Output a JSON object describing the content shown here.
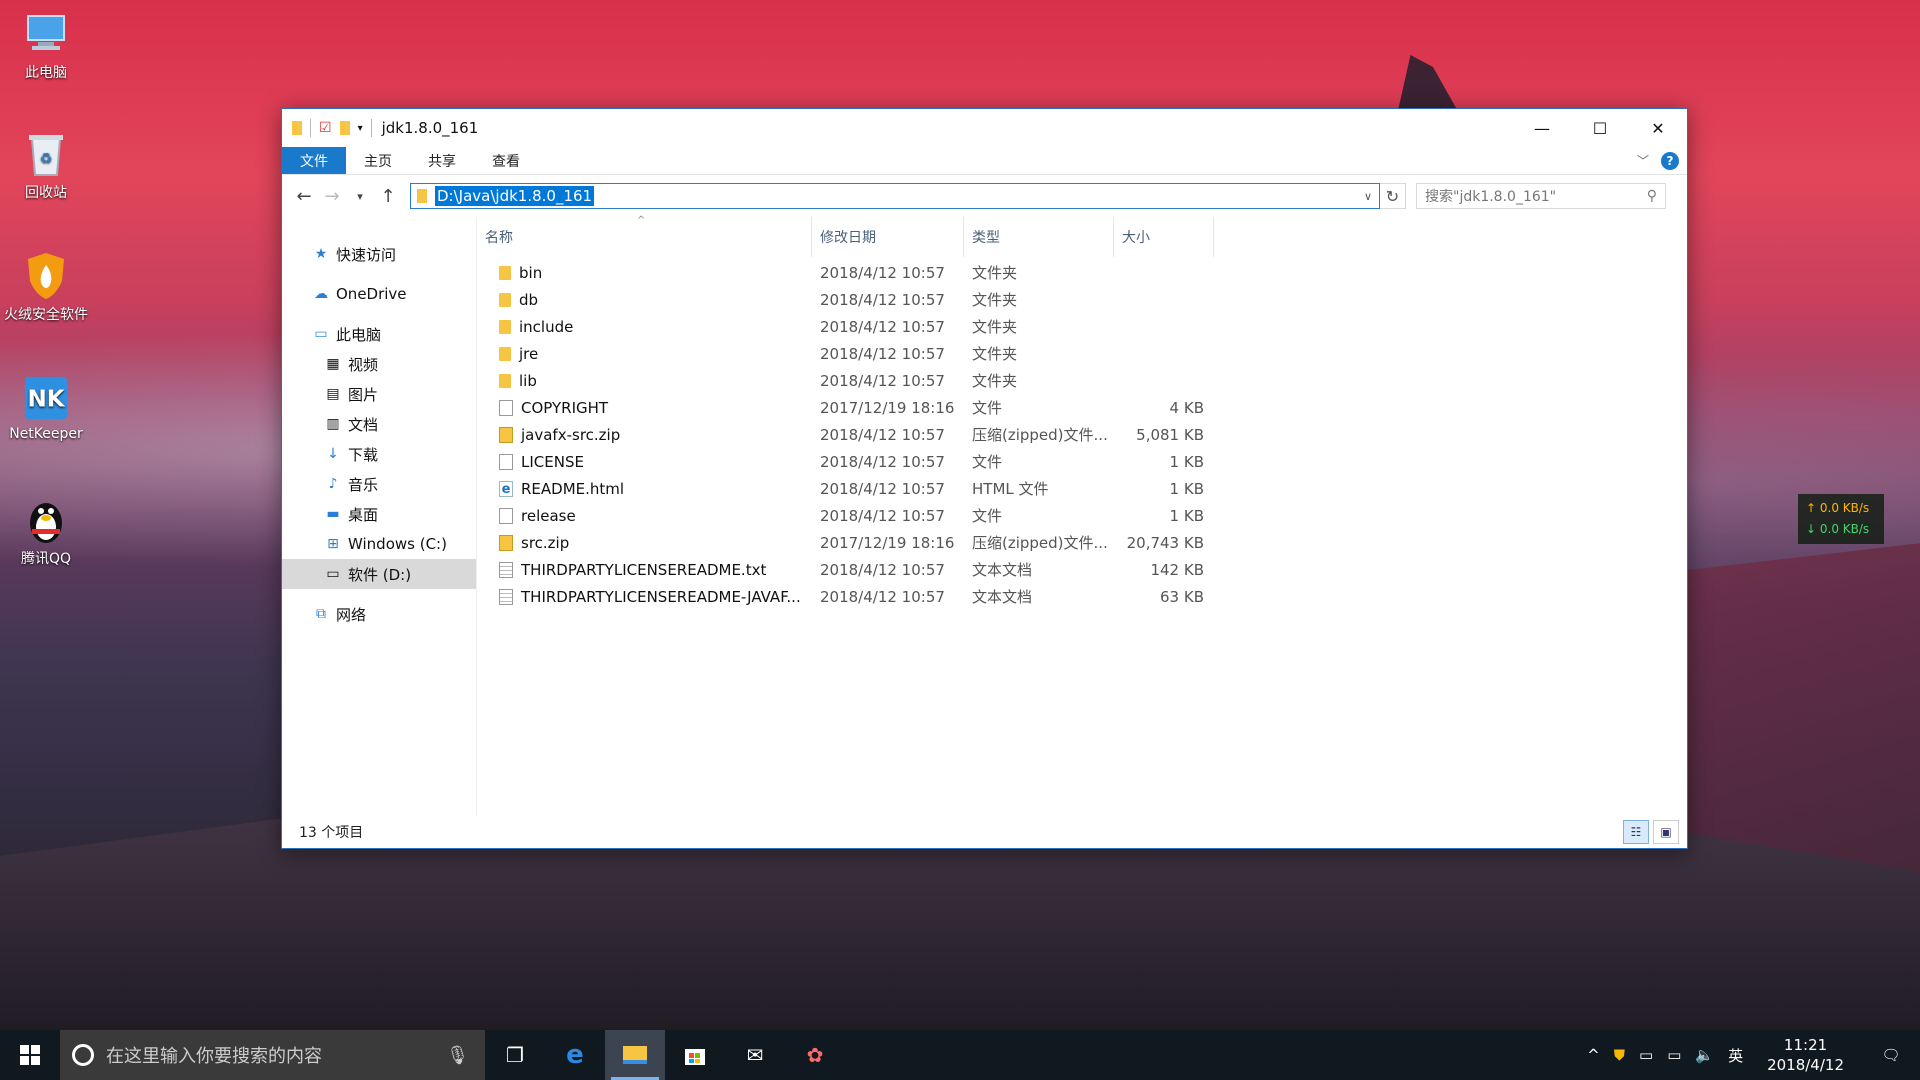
{
  "desktop": {
    "icons": [
      {
        "label": "此电脑"
      },
      {
        "label": "回收站"
      },
      {
        "label": "火绒安全软件"
      },
      {
        "label": "NetKeeper"
      },
      {
        "label": "腾讯QQ"
      }
    ]
  },
  "window": {
    "title": "jdk1.8.0_161",
    "ribbon_tabs": [
      {
        "label": "文件",
        "active": true
      },
      {
        "label": "主页"
      },
      {
        "label": "共享"
      },
      {
        "label": "查看"
      }
    ],
    "help_label": "?",
    "address": "D:\\Java\\jdk1.8.0_161",
    "search_placeholder": "搜索\"jdk1.8.0_161\"",
    "nav": {
      "quick_access": "快速访问",
      "onedrive": "OneDrive",
      "this_pc": "此电脑",
      "pc_items": [
        "视频",
        "图片",
        "文档",
        "下载",
        "音乐",
        "桌面",
        "Windows (C:)",
        "软件 (D:)"
      ],
      "network": "网络"
    },
    "columns": {
      "name": "名称",
      "date": "修改日期",
      "type": "类型",
      "size": "大小"
    },
    "files": [
      {
        "name": "bin",
        "date": "2018/4/12 10:57",
        "type": "文件夹",
        "size": "",
        "icon": "folder"
      },
      {
        "name": "db",
        "date": "2018/4/12 10:57",
        "type": "文件夹",
        "size": "",
        "icon": "folder"
      },
      {
        "name": "include",
        "date": "2018/4/12 10:57",
        "type": "文件夹",
        "size": "",
        "icon": "folder"
      },
      {
        "name": "jre",
        "date": "2018/4/12 10:57",
        "type": "文件夹",
        "size": "",
        "icon": "folder"
      },
      {
        "name": "lib",
        "date": "2018/4/12 10:57",
        "type": "文件夹",
        "size": "",
        "icon": "folder"
      },
      {
        "name": "COPYRIGHT",
        "date": "2017/12/19 18:16",
        "type": "文件",
        "size": "4 KB",
        "icon": "file"
      },
      {
        "name": "javafx-src.zip",
        "date": "2018/4/12 10:57",
        "type": "压缩(zipped)文件...",
        "size": "5,081 KB",
        "icon": "zip"
      },
      {
        "name": "LICENSE",
        "date": "2018/4/12 10:57",
        "type": "文件",
        "size": "1 KB",
        "icon": "file"
      },
      {
        "name": "README.html",
        "date": "2018/4/12 10:57",
        "type": "HTML 文件",
        "size": "1 KB",
        "icon": "html"
      },
      {
        "name": "release",
        "date": "2018/4/12 10:57",
        "type": "文件",
        "size": "1 KB",
        "icon": "file"
      },
      {
        "name": "src.zip",
        "date": "2017/12/19 18:16",
        "type": "压缩(zipped)文件...",
        "size": "20,743 KB",
        "icon": "zip"
      },
      {
        "name": "THIRDPARTYLICENSEREADME.txt",
        "date": "2018/4/12 10:57",
        "type": "文本文档",
        "size": "142 KB",
        "icon": "txt"
      },
      {
        "name": "THIRDPARTYLICENSEREADME-JAVAF...",
        "date": "2018/4/12 10:57",
        "type": "文本文档",
        "size": "63 KB",
        "icon": "txt"
      }
    ],
    "status": "13 个项目"
  },
  "netspeed": {
    "up": "↑ 0.0 KB/s",
    "down": "↓ 0.0 KB/s"
  },
  "taskbar": {
    "search_placeholder": "在这里输入你要搜索的内容",
    "ime": "英",
    "time": "11:21",
    "date": "2018/4/12"
  }
}
